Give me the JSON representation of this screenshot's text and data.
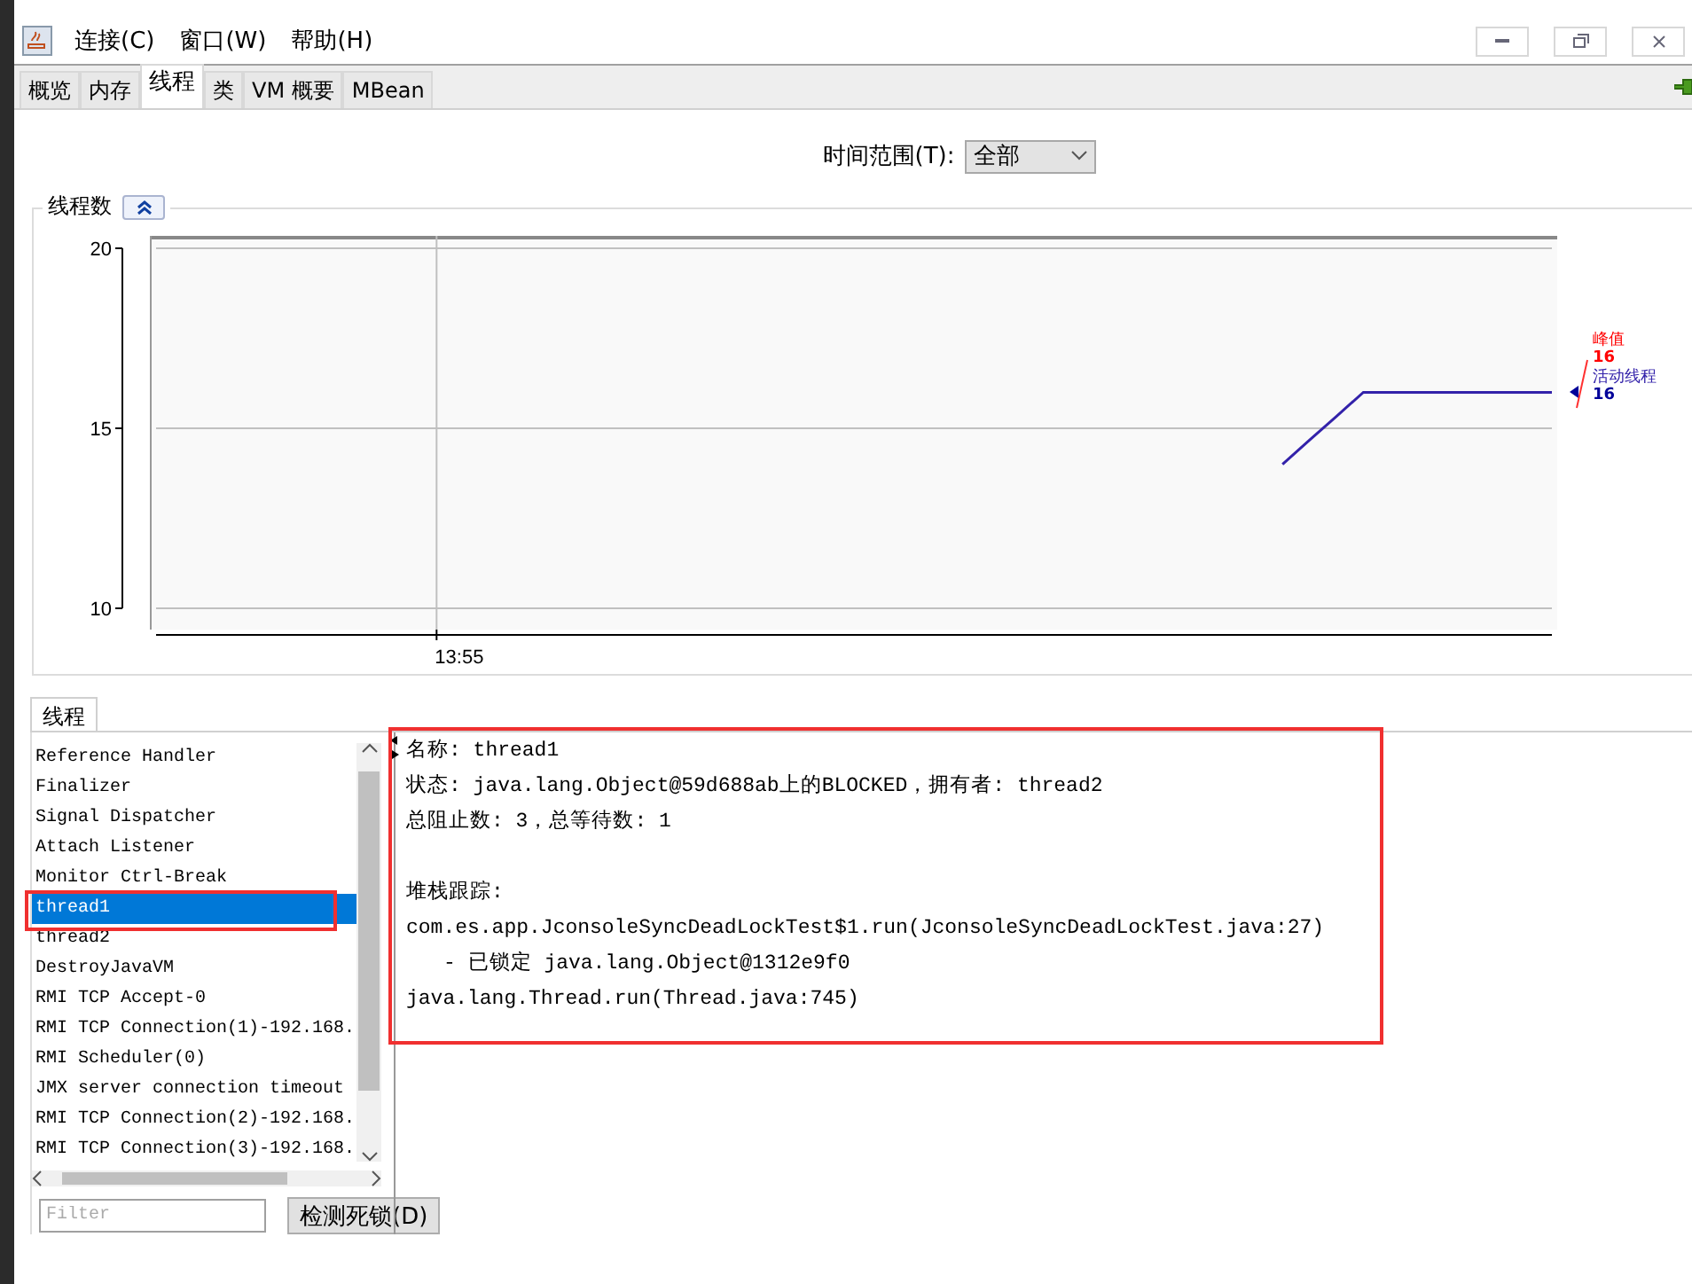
{
  "menu": [
    "连接(C)",
    "窗口(W)",
    "帮助(H)"
  ],
  "tabs": [
    {
      "label": "概览",
      "selected": false
    },
    {
      "label": "内存",
      "selected": false
    },
    {
      "label": "线程",
      "selected": true
    },
    {
      "label": "类",
      "selected": false
    },
    {
      "label": "VM 概要",
      "selected": false
    },
    {
      "label": "MBean",
      "selected": false
    }
  ],
  "time_range": {
    "label": "时间范围(T):",
    "value": "全部"
  },
  "thread_chart": {
    "title": "线程数",
    "peak": {
      "label": "峰值",
      "value": "16",
      "color": "#ff0000"
    },
    "current_value": "16",
    "chart_data": {
      "type": "line",
      "ylim": [
        10,
        20
      ],
      "yticks": [
        {
          "value": 10,
          "label": "10"
        },
        {
          "value": 15,
          "label": "15"
        },
        {
          "value": 20,
          "label": "20"
        }
      ],
      "annotations": [
        "13:55"
      ],
      "series": [
        {
          "name": "活动线程",
          "color": "#3322aa",
          "values": [
            null,
            null,
            null,
            null,
            null,
            null,
            null,
            null,
            null,
            null,
            null,
            null,
            null,
            null,
            null,
            null,
            null,
            null,
            null,
            null,
            null,
            null,
            null,
            null,
            null,
            null,
            null,
            null,
            null,
            null,
            null,
            null,
            null,
            null,
            null,
            null,
            null,
            null,
            null,
            null,
            null,
            null,
            14,
            14.67,
            15.33,
            16,
            16,
            16,
            16,
            16,
            16,
            16,
            16
          ]
        }
      ]
    }
  },
  "thread_panel": {
    "tab": {
      "label": "线程",
      "selected": true
    },
    "threads": [
      {
        "name": "Reference Handler",
        "selected": false,
        "highlighted": false
      },
      {
        "name": "Finalizer",
        "selected": false,
        "highlighted": false
      },
      {
        "name": "Signal Dispatcher",
        "selected": false,
        "highlighted": false
      },
      {
        "name": "Attach Listener",
        "selected": false,
        "highlighted": false
      },
      {
        "name": "Monitor Ctrl-Break",
        "selected": false,
        "highlighted": false
      },
      {
        "name": "thread1",
        "selected": true,
        "highlighted": true
      },
      {
        "name": "thread2",
        "selected": false,
        "highlighted": false
      },
      {
        "name": "DestroyJavaVM",
        "selected": false,
        "highlighted": false
      },
      {
        "name": "RMI TCP Accept-0",
        "selected": false,
        "highlighted": false
      },
      {
        "name": "RMI TCP Connection(1)-192.168.",
        "selected": false,
        "highlighted": false
      },
      {
        "name": "RMI Scheduler(0)",
        "selected": false,
        "highlighted": false
      },
      {
        "name": "JMX server connection timeout",
        "selected": false,
        "highlighted": false
      },
      {
        "name": "RMI TCP Connection(2)-192.168.",
        "selected": false,
        "highlighted": false
      },
      {
        "name": "RMI TCP Connection(3)-192.168.",
        "selected": false,
        "highlighted": false
      }
    ],
    "details": {
      "highlighted": true,
      "info": [
        "名称: thread1",
        "状态: java.lang.Object@59d688ab上的BLOCKED，拥有者: thread2",
        "总阻止数: 3，总等待数: 1"
      ],
      "stack_title": "堆栈跟踪:",
      "stack": [
        {
          "kind": "frame",
          "text": "com.es.app.JconsoleSyncDeadLockTest$1.run(JconsoleSyncDeadLockTest.java:27)"
        },
        {
          "kind": "lock",
          "text": "- 已锁定 java.lang.Object@1312e9f0"
        },
        {
          "kind": "frame",
          "text": "java.lang.Thread.run(Thread.java:745)"
        }
      ]
    },
    "filter": {
      "placeholder": "Filter"
    },
    "detect_button": "检测死锁(D)"
  }
}
